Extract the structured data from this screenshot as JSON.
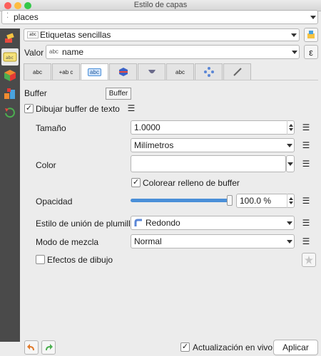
{
  "window": {
    "title": "Estilo de capas"
  },
  "layer_select": {
    "value": "places"
  },
  "renderer": {
    "value": "Etiquetas sencillas",
    "badge": "abc"
  },
  "value_field": {
    "label": "Valor",
    "value": "name",
    "prefix": "abc",
    "expr_button": "ε"
  },
  "tabs": [
    {
      "name": "text",
      "glyph": "abc"
    },
    {
      "name": "formatting",
      "glyph": "+ab c"
    },
    {
      "name": "buffer",
      "glyph": "abc"
    },
    {
      "name": "background",
      "glyph": "▬"
    },
    {
      "name": "shadow",
      "glyph": "◖"
    },
    {
      "name": "callouts",
      "glyph": "abc"
    },
    {
      "name": "placement",
      "glyph": "✥"
    },
    {
      "name": "rendering",
      "glyph": "✎"
    }
  ],
  "tooltip": "Buffer",
  "buffer": {
    "section_title": "Buffer",
    "draw_buffer_label": "Dibujar buffer de texto",
    "draw_buffer_checked": true,
    "size_label": "Tamaño",
    "size_value": "1.0000",
    "units_value": "Milímetros",
    "color_label": "Color",
    "color_value": "#ffffff",
    "fill_label": "Colorear relleno de buffer",
    "fill_checked": true,
    "opacity_label": "Opacidad",
    "opacity_value": "100.0 %",
    "opacity_fraction": 1.0,
    "join_label": "Estilo de unión de plumilla",
    "join_value": "Redondo",
    "blend_label": "Modo de mezcla",
    "blend_value": "Normal",
    "effects_label": "Efectos de dibujo",
    "effects_checked": false
  },
  "footer": {
    "live_update_label": "Actualización en vivo",
    "live_update_checked": true,
    "apply_label": "Aplicar"
  }
}
